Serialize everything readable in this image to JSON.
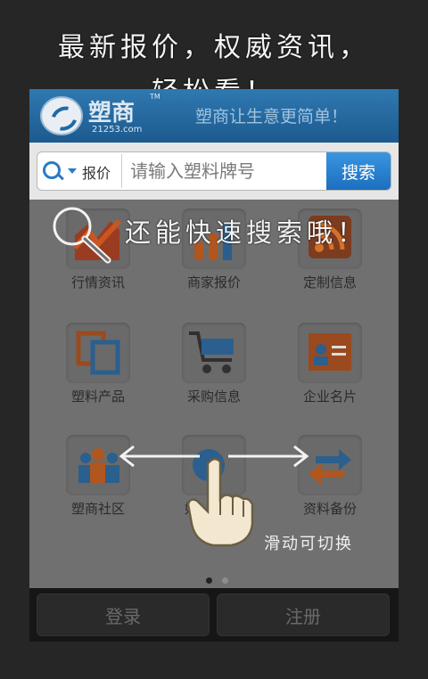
{
  "headline": {
    "line1": "最新报价，权威资讯，",
    "line2": "轻松看！"
  },
  "header": {
    "logo_name": "塑商",
    "logo_tm": "TM",
    "logo_url": "21253.com",
    "slogan": "塑商让生意更简单！"
  },
  "search": {
    "category": "报价",
    "placeholder": "请输入塑料牌号",
    "button": "搜索"
  },
  "overlay": {
    "search_tip": "还能快速搜索哦！",
    "swipe_tip": "滑动可切换"
  },
  "grid": {
    "items": [
      {
        "label": "行情资讯",
        "icon": "market-news-icon"
      },
      {
        "label": "商家报价",
        "icon": "merchant-quote-icon"
      },
      {
        "label": "定制信息",
        "icon": "rss-icon"
      },
      {
        "label": "塑料产品",
        "icon": "plastic-products-icon"
      },
      {
        "label": "采购信息",
        "icon": "shopping-cart-icon"
      },
      {
        "label": "企业名片",
        "icon": "business-card-icon"
      },
      {
        "label": "塑商社区",
        "icon": "community-icon"
      },
      {
        "label": "好",
        "icon": "friends-icon"
      },
      {
        "label": "资料备份",
        "icon": "backup-icon"
      }
    ]
  },
  "pager": {
    "current": 1,
    "total": 2
  },
  "footer": {
    "login": "登录",
    "register": "注册"
  },
  "colors": {
    "brand_blue": "#2a7ac6",
    "header_blue": "#1c5a8f",
    "dim_overlay": "#707070"
  }
}
